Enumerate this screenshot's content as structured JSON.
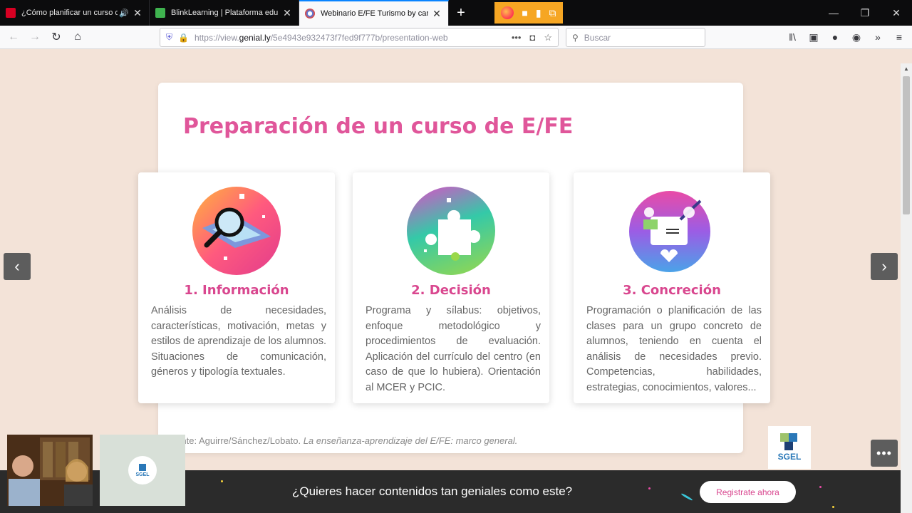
{
  "browser": {
    "tabs": [
      {
        "label": "¿Cómo planificar un curso d",
        "audio_icon": "speaker-icon",
        "active": false,
        "favicon_color": "#d70022"
      },
      {
        "label": "BlinkLearning | Plataforma edu",
        "active": false,
        "favicon_color": "#3fb34f"
      },
      {
        "label": "Webinario E/FE Turismo by car",
        "active": true,
        "favicon_color": "#4285f4"
      }
    ],
    "new_tab_label": "+",
    "url_prefix": "https://view.",
    "url_domain": "genial.ly",
    "url_path": "/5e4943e932473f7fed9f777b/presentation-web",
    "search_placeholder": "Buscar"
  },
  "slide": {
    "title": "Preparación de un curso de E/FE",
    "cards": [
      {
        "title": "1. Información",
        "description": "Análisis de necesidades, características, motivación, metas y estilos de aprendizaje de los alumnos. Situaciones de comunicación, géneros y tipología textuales."
      },
      {
        "title": "2. Decisión",
        "description": "Programa y sílabus: objetivos, enfoque metodológico y procedimientos de evaluación. Aplicación del currículo del centro (en caso de que lo hubiera). Orientación al MCER y PCIC."
      },
      {
        "title": "3. Concreción",
        "description": "Programación o planificación de las clases para un grupo concreto de alumnos, teniendo en cuenta el análisis de necesidades previo. Competencias, habilidades, estrategias, conocimientos, valores..."
      }
    ],
    "source_prefix": "Fuente: Aguirre/Sánchez/Lobato. ",
    "source_title": "La enseñanza-aprendizaje del E/FE: marco general."
  },
  "logo": {
    "text": "SGEL"
  },
  "banner": {
    "question": "¿Quieres hacer contenidos tan geniales como este?",
    "cta": "Registrate ahora"
  },
  "colors": {
    "accent_pink": "#e0569a",
    "page_bg": "#f3e3d8",
    "banner_bg": "#2b2b2b"
  }
}
